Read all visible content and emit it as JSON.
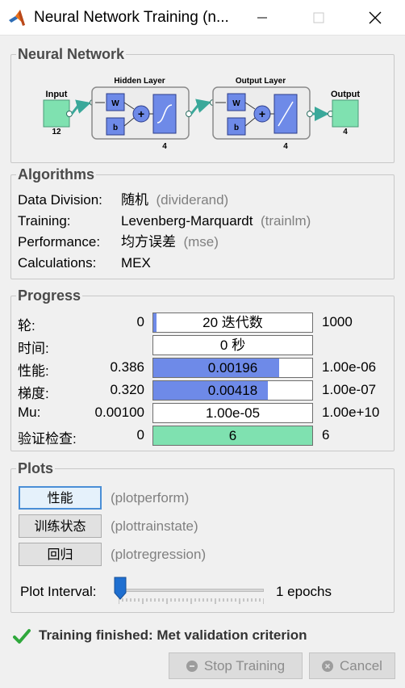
{
  "window": {
    "title": "Neural Network Training (n..."
  },
  "network": {
    "section_title": "Neural Network",
    "input_label": "Input",
    "input_size": "12",
    "hidden_title": "Hidden Layer",
    "hidden_size": "4",
    "output_title": "Output Layer",
    "output_size": "4",
    "output_label": "Output",
    "output_count": "4",
    "weight_label": "W",
    "bias_label": "b",
    "plus_sign": "+"
  },
  "algorithms": {
    "section_title": "Algorithms",
    "rows": [
      {
        "label": "Data Division:",
        "value": "随机",
        "func": "(dividerand)"
      },
      {
        "label": "Training:",
        "value": "Levenberg-Marquardt",
        "func": "(trainlm)"
      },
      {
        "label": "Performance:",
        "value": "均方误差",
        "func": "(mse)"
      },
      {
        "label": "Calculations:",
        "value": "MEX",
        "func": ""
      }
    ]
  },
  "progress": {
    "section_title": "Progress",
    "rows": [
      {
        "label": "轮:",
        "min": "0",
        "text": "20 迭代数",
        "max": "1000",
        "fill_fraction": 0.02,
        "fill_color": "#6e8ae8"
      },
      {
        "label": "时间:",
        "min": "",
        "text": "0 秒",
        "max": "",
        "fill_fraction": 0,
        "fill_color": "#6e8ae8"
      },
      {
        "label": "性能:",
        "min": "0.386",
        "text": "0.00196",
        "max": "1.00e-06",
        "fill_fraction": 0.79,
        "fill_color": "#6e8ae8"
      },
      {
        "label": "梯度:",
        "min": "0.320",
        "text": "0.00418",
        "max": "1.00e-07",
        "fill_fraction": 0.72,
        "fill_color": "#6e8ae8"
      },
      {
        "label": "Mu:",
        "min": "0.00100",
        "text": "1.00e-05",
        "max": "1.00e+10",
        "fill_fraction": 0,
        "fill_color": "#6e8ae8"
      },
      {
        "label": "验证检查:",
        "min": "0",
        "text": "6",
        "max": "6",
        "fill_fraction": 1,
        "fill_color": "#7fe1b0"
      }
    ]
  },
  "plots": {
    "section_title": "Plots",
    "buttons": [
      {
        "label": "性能",
        "func": "(plotperform)"
      },
      {
        "label": "训练状态",
        "func": "(plottrainstate)"
      },
      {
        "label": "回归",
        "func": "(plotregression)"
      }
    ],
    "interval_label": "Plot Interval:",
    "interval_value": "1 epochs",
    "slider_fraction": 0
  },
  "status": {
    "text": "Training finished: Met validation criterion"
  },
  "buttons": {
    "stop": "Stop Training",
    "cancel": "Cancel"
  },
  "colors": {
    "block_green": "#7fe1b0",
    "block_blue": "#6e8ae8",
    "arrow_teal": "#3aa89a",
    "focus_blue": "#4a8ed6",
    "check_green": "#2fa83c"
  }
}
